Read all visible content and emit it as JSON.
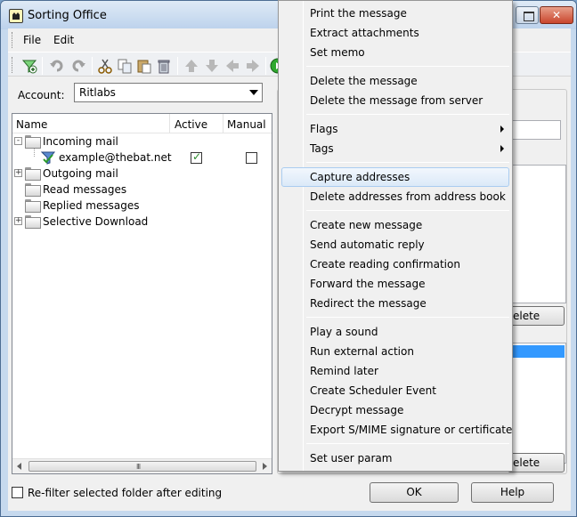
{
  "window": {
    "title": "Sorting Office"
  },
  "menubar": {
    "file": "File",
    "edit": "Edit"
  },
  "toolbar": {
    "icons": [
      "new-filter-icon",
      "undo-icon",
      "redo-icon",
      "cut-icon",
      "copy-icon",
      "paste-icon",
      "recycle-bin-icon",
      "move-up-icon",
      "move-down-icon",
      "move-left-icon",
      "move-right-icon",
      "run-icon"
    ]
  },
  "account": {
    "label": "Account:",
    "value": "Ritlabs"
  },
  "tree": {
    "columns": {
      "name": "Name",
      "active": "Active",
      "manual": "Manual"
    },
    "rows": [
      {
        "label": "Incoming mail",
        "expander": "-"
      },
      {
        "label": "example@thebat.net",
        "active": true,
        "manual": false
      },
      {
        "label": "Outgoing mail",
        "expander": "+"
      },
      {
        "label": "Read messages"
      },
      {
        "label": "Replied messages"
      },
      {
        "label": "Selective Download",
        "expander": "+"
      }
    ],
    "scroll_thumb": "III"
  },
  "right_panel": {
    "delete_label_1": "elete",
    "delete_label_2": "elete"
  },
  "refilter": {
    "label": "Re-filter selected folder after editing",
    "checked": false
  },
  "buttons": {
    "ok": "OK",
    "help": "Help"
  },
  "context_menu": {
    "groups": [
      [
        "Print the message",
        "Extract attachments",
        "Set memo"
      ],
      [
        "Delete the message",
        "Delete the message from server"
      ],
      [
        "Flags",
        "Tags"
      ],
      [
        "Capture addresses",
        "Delete addresses from address book"
      ],
      [
        "Create new message",
        "Send automatic reply",
        "Create reading confirmation",
        "Forward the message",
        "Redirect the message"
      ],
      [
        "Play a sound",
        "Run external action",
        "Remind later",
        "Create Scheduler Event",
        "Decrypt message",
        "Export S/MIME signature or certificate"
      ],
      [
        "Set user param"
      ]
    ],
    "items": {
      "print": "Print the message",
      "extract": "Extract attachments",
      "memo": "Set memo",
      "delete_msg": "Delete the message",
      "delete_server": "Delete the message from server",
      "flags": "Flags",
      "tags": "Tags",
      "capture": "Capture addresses",
      "delete_addr": "Delete addresses from address book",
      "create_new": "Create new message",
      "auto_reply": "Send automatic reply",
      "read_confirm": "Create reading confirmation",
      "forward": "Forward the message",
      "redirect": "Redirect the message",
      "sound": "Play a sound",
      "external": "Run external action",
      "remind": "Remind later",
      "scheduler": "Create Scheduler Event",
      "decrypt": "Decrypt message",
      "export_smime": "Export S/MIME signature or certificate",
      "user_param": "Set user param"
    },
    "highlighted": "Capture addresses",
    "submenu_items": [
      "Flags",
      "Tags"
    ]
  },
  "colors": {
    "selection": "#3399ff",
    "titlebar": "#c6d9ee"
  }
}
